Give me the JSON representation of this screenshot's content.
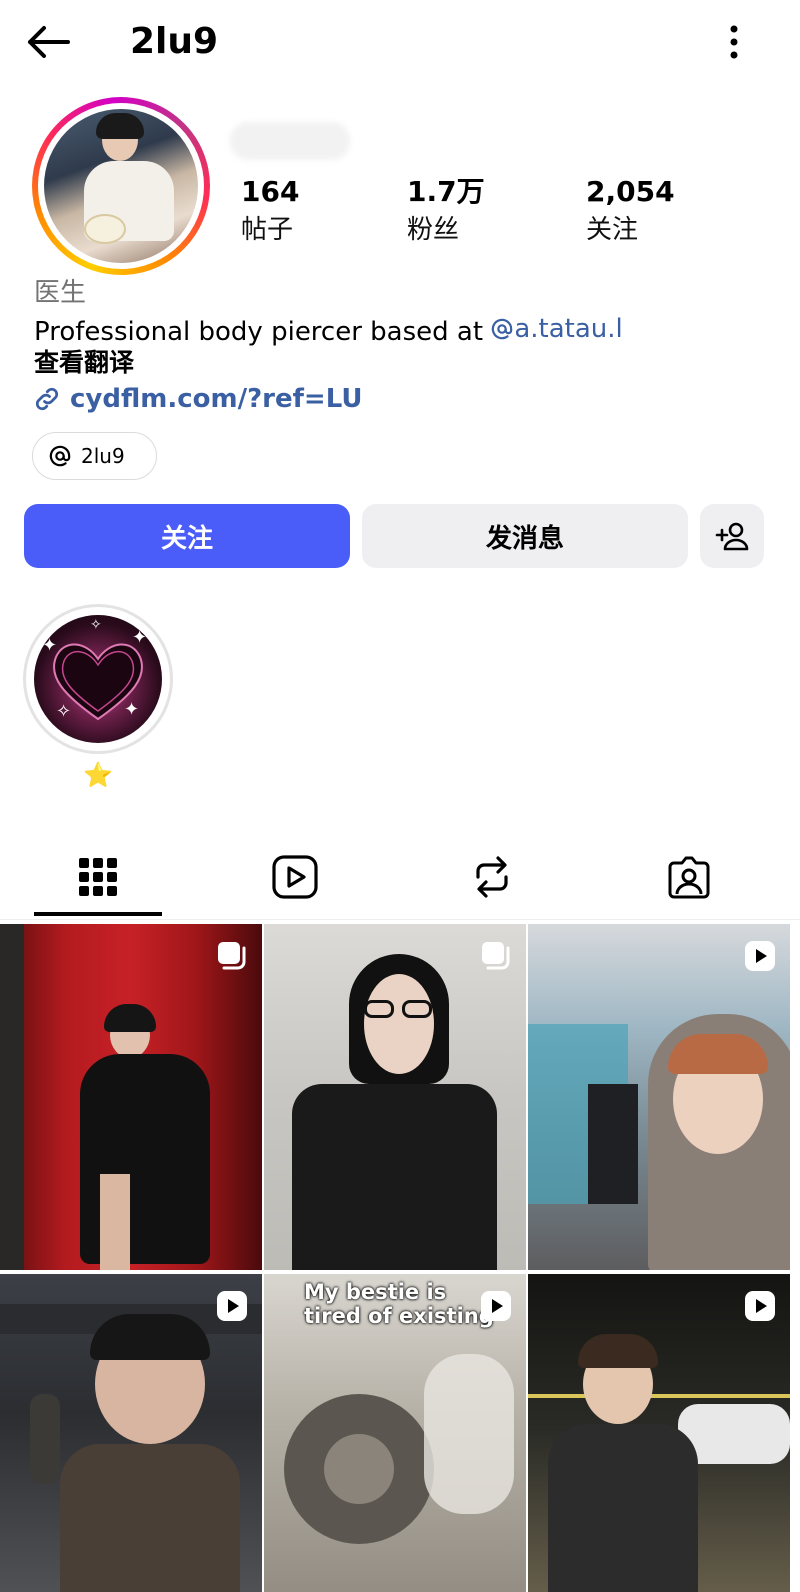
{
  "header": {
    "username": "2lu9"
  },
  "stats": [
    {
      "value": "164",
      "label": "帖子"
    },
    {
      "value": "1.7万",
      "label": "粉丝"
    },
    {
      "value": "2,054",
      "label": "关注"
    }
  ],
  "profile": {
    "category": "医生",
    "bio_text": "Professional body piercer based at ",
    "bio_mention": "a.tatau.l",
    "translate_label": "查看翻译",
    "link": "cydflm.com/?ref=LU",
    "threads_handle": "2lu9"
  },
  "actions": {
    "follow_label": "关注",
    "message_label": "发消息"
  },
  "highlights": [
    {
      "label": "⭐"
    }
  ],
  "tabs": [
    {
      "icon": "grid-icon",
      "active": true
    },
    {
      "icon": "reels-icon",
      "active": false
    },
    {
      "icon": "reposts-icon",
      "active": false
    },
    {
      "icon": "tagged-icon",
      "active": false
    }
  ],
  "posts": [
    {
      "type": "carousel",
      "caption": ""
    },
    {
      "type": "carousel",
      "caption": ""
    },
    {
      "type": "reel",
      "caption": ""
    },
    {
      "type": "reel",
      "caption": ""
    },
    {
      "type": "reel",
      "caption": "My bestie is tired of existing"
    },
    {
      "type": "reel",
      "caption": ""
    }
  ],
  "colors": {
    "accent": "#4a5df9",
    "link": "#3b5fa3",
    "secondary_button": "#efeff2"
  }
}
